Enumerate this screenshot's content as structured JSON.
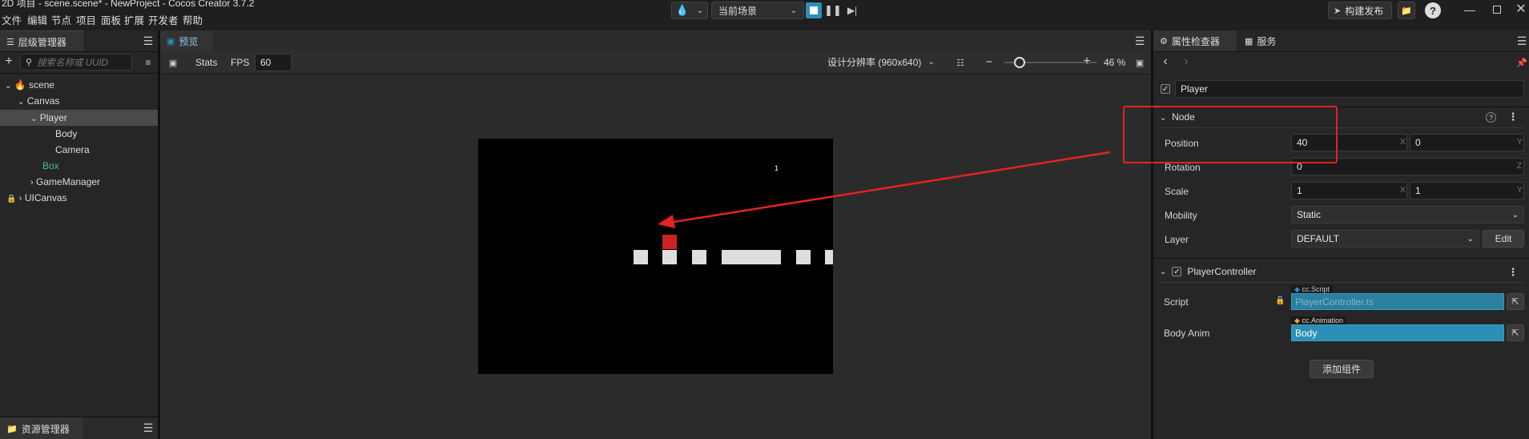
{
  "window": {
    "title": "2D 项目 - scene.scene* - NewProject - Cocos Creator 3.7.2",
    "publish_label": "构建发布"
  },
  "menu": [
    "文件",
    "编辑",
    "节点",
    "项目",
    "面板",
    "扩展",
    "开发者",
    "帮助"
  ],
  "toolbar": {
    "scene_select": "当前场景"
  },
  "hierarchy": {
    "tab": "层级管理器",
    "search_placeholder": "搜索名称或 UUID",
    "items": [
      {
        "label": "scene"
      },
      {
        "label": "Canvas"
      },
      {
        "label": "Player"
      },
      {
        "label": "Body"
      },
      {
        "label": "Camera"
      },
      {
        "label": "Box"
      },
      {
        "label": "GameManager"
      },
      {
        "label": "UICanvas"
      }
    ]
  },
  "assets": {
    "tab": "资源管理器"
  },
  "preview": {
    "tab": "预览",
    "stats_label": "Stats",
    "fps_label": "FPS",
    "fps_value": "60",
    "resolution": "设计分辨率 (960x640)",
    "zoom": "46 %",
    "zoom_level": 0.46,
    "score_text": "1"
  },
  "inspector": {
    "tabs": [
      "属性检查器",
      "服务"
    ],
    "node_name": "Player",
    "section_node": "Node",
    "position_label": "Position",
    "position_x": "40",
    "position_y": "0",
    "rotation_label": "Rotation",
    "rotation_z": "0",
    "scale_label": "Scale",
    "scale_x": "1",
    "scale_y": "1",
    "mobility_label": "Mobility",
    "mobility_value": "Static",
    "layer_label": "Layer",
    "layer_value": "DEFAULT",
    "edit_label": "Edit",
    "component_name": "PlayerController",
    "script_label": "Script",
    "script_type": "cc.Script",
    "script_value": "PlayerController.ts",
    "bodyanim_label": "Body Anim",
    "bodyanim_type": "cc.Animation",
    "bodyanim_value": "Body",
    "add_component": "添加组件",
    "axis": {
      "x": "X",
      "y": "Y",
      "z": "Z"
    }
  },
  "colors": {
    "accent": "#2b8fb8",
    "highlight": "#e52222",
    "box_text": "#4fc08d",
    "player": "#cc2222"
  }
}
